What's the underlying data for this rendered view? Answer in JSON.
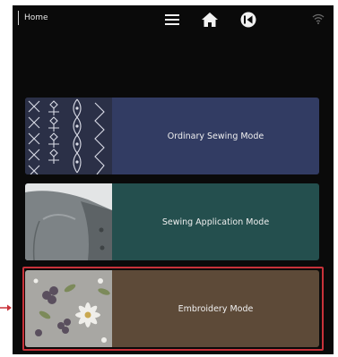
{
  "topbar": {
    "home_label": "Home",
    "icons": [
      "menu-icon",
      "home-icon",
      "back-icon",
      "wifi-icon"
    ]
  },
  "modes": [
    {
      "label": "Ordinary Sewing Mode",
      "color": "#323c63"
    },
    {
      "label": "Sewing Application Mode",
      "color": "#244f4e"
    },
    {
      "label": "Embroidery Mode",
      "color": "#5d4a38",
      "selected": true
    }
  ],
  "colors": {
    "background": "#0a0a0a",
    "highlight": "#c8323a"
  }
}
